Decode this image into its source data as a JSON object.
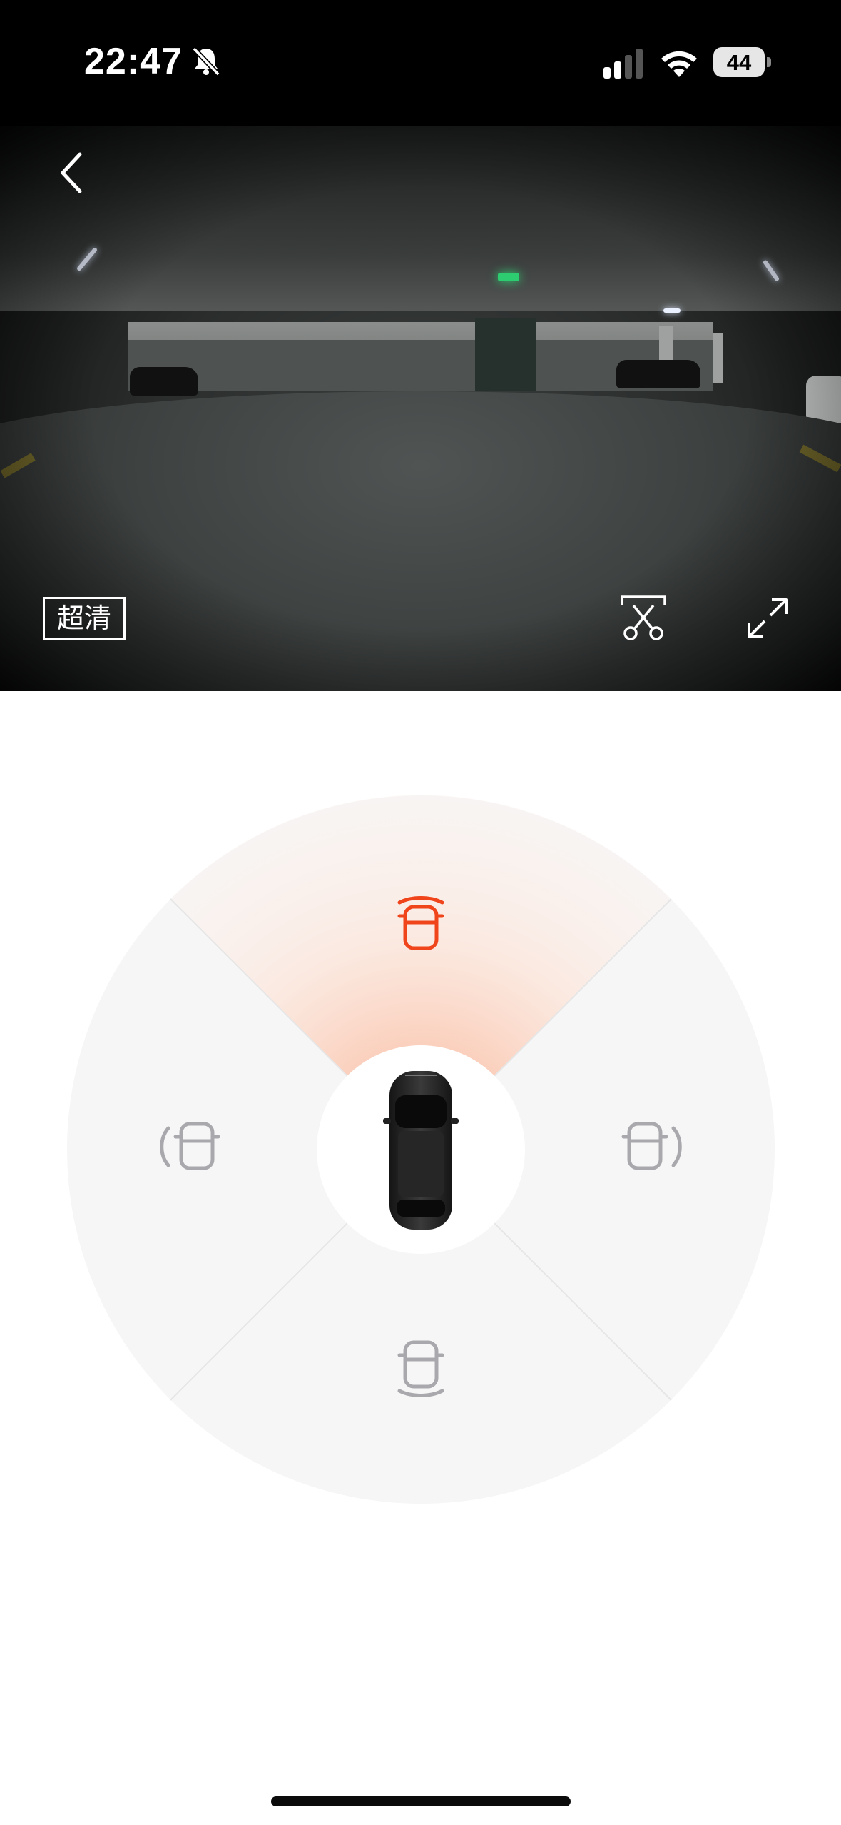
{
  "status_bar": {
    "time": "22:47",
    "battery": "44",
    "icons": [
      "bell-slash-icon",
      "cellular-signal-icon",
      "wifi-icon",
      "battery-icon"
    ]
  },
  "camera": {
    "quality_label": "超清",
    "active_view": "front",
    "icons": [
      "back-chevron-icon",
      "scissors-clip-icon",
      "expand-icon"
    ]
  },
  "wheel": {
    "views": [
      "front",
      "left",
      "right",
      "rear"
    ],
    "selected": "front",
    "colors": {
      "active": "#f0441b",
      "inactive": "#a9a9ad",
      "background": "#f6f6f6"
    },
    "icons": [
      "car-front-camera-icon",
      "car-left-camera-icon",
      "car-right-camera-icon",
      "car-rear-camera-icon",
      "car-top-view-icon"
    ]
  }
}
